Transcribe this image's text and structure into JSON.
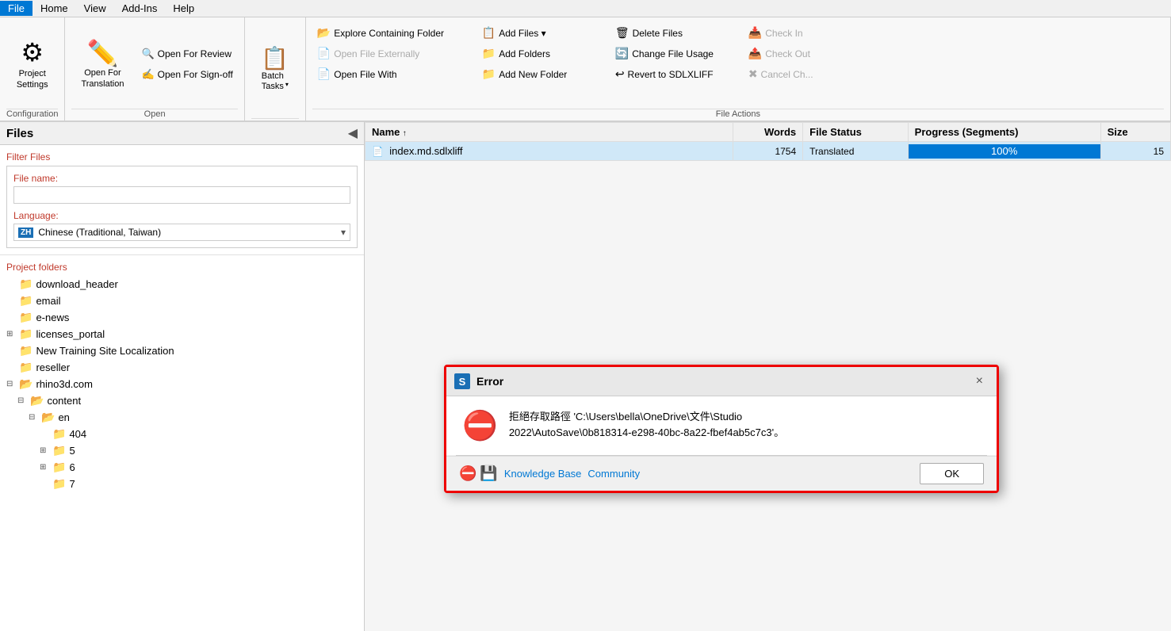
{
  "menubar": {
    "items": [
      {
        "label": "File",
        "active": true
      },
      {
        "label": "Home",
        "active": false
      },
      {
        "label": "View",
        "active": false
      },
      {
        "label": "Add-Ins",
        "active": false
      },
      {
        "label": "Help",
        "active": false
      }
    ]
  },
  "ribbon": {
    "groups": [
      {
        "name": "configuration",
        "label": "Configuration",
        "buttons": [
          {
            "label": "Project\nSettings",
            "sublabel": "Configuration",
            "type": "large",
            "icon": "gear"
          }
        ]
      },
      {
        "name": "open",
        "label": "Open",
        "buttons": [
          {
            "label": "Open For\nTranslation",
            "type": "large",
            "icon": "pencil"
          },
          {
            "label": "Open For Review",
            "type": "small",
            "icon": "review"
          },
          {
            "label": "Open For Sign-off",
            "type": "small",
            "icon": "signoff"
          }
        ]
      },
      {
        "name": "batch",
        "label": "",
        "buttons": [
          {
            "label": "Batch\nTasks",
            "type": "large",
            "icon": "batch"
          }
        ]
      },
      {
        "name": "file-actions",
        "label": "File Actions",
        "buttons": [
          {
            "label": "Explore Containing Folder",
            "type": "small",
            "icon": "folder-open",
            "disabled": false
          },
          {
            "label": "Open File Externally",
            "type": "small",
            "icon": "file-ext",
            "disabled": true
          },
          {
            "label": "Open File With",
            "type": "small",
            "icon": "file-with",
            "disabled": false
          },
          {
            "label": "Add Files",
            "type": "small",
            "icon": "add-files",
            "disabled": false
          },
          {
            "label": "Add Folders",
            "type": "small",
            "icon": "add-folder",
            "disabled": false
          },
          {
            "label": "Add New Folder",
            "type": "small",
            "icon": "add-new-folder",
            "disabled": false
          },
          {
            "label": "Delete Files",
            "type": "small",
            "icon": "delete",
            "disabled": false
          },
          {
            "label": "Change File Usage",
            "type": "small",
            "icon": "change-usage",
            "disabled": false
          },
          {
            "label": "Revert to SDLXLIFF",
            "type": "small",
            "icon": "revert",
            "disabled": false
          },
          {
            "label": "Check In",
            "type": "small",
            "icon": "checkin",
            "disabled": true
          },
          {
            "label": "Check Out",
            "type": "small",
            "icon": "checkout",
            "disabled": true
          },
          {
            "label": "Cancel Ch...",
            "type": "small",
            "icon": "cancelch",
            "disabled": true
          }
        ]
      }
    ]
  },
  "leftpanel": {
    "title": "Files",
    "filter": {
      "title": "Filter Files",
      "filename_label": "File name:",
      "filename_placeholder": "",
      "language_label": "Language:",
      "language_flag": "ZH",
      "language_name": "Chinese (Traditional, Taiwan)"
    },
    "folders_title": "Project folders",
    "folders": [
      {
        "name": "download_header",
        "level": 0,
        "expanded": false,
        "has_children": false
      },
      {
        "name": "email",
        "level": 0,
        "expanded": false,
        "has_children": false
      },
      {
        "name": "e-news",
        "level": 0,
        "expanded": false,
        "has_children": false
      },
      {
        "name": "licenses_portal",
        "level": 0,
        "expanded": true,
        "has_children": true
      },
      {
        "name": "New Training Site Localization",
        "level": 0,
        "expanded": false,
        "has_children": false
      },
      {
        "name": "reseller",
        "level": 0,
        "expanded": false,
        "has_children": false
      },
      {
        "name": "rhino3d.com",
        "level": 0,
        "expanded": true,
        "has_children": true
      },
      {
        "name": "content",
        "level": 1,
        "expanded": true,
        "has_children": true
      },
      {
        "name": "en",
        "level": 2,
        "expanded": true,
        "has_children": true
      },
      {
        "name": "404",
        "level": 3,
        "expanded": false,
        "has_children": false
      },
      {
        "name": "5",
        "level": 3,
        "expanded": true,
        "has_children": true
      },
      {
        "name": "6",
        "level": 3,
        "expanded": true,
        "has_children": true
      },
      {
        "name": "7",
        "level": 3,
        "expanded": false,
        "has_children": false
      }
    ]
  },
  "filetable": {
    "columns": [
      {
        "label": "Name",
        "sortable": true
      },
      {
        "label": "Words"
      },
      {
        "label": "File Status"
      },
      {
        "label": "Progress (Segments)"
      },
      {
        "label": "Size"
      }
    ],
    "rows": [
      {
        "name": "index.md.sdlxliff",
        "words": "1754",
        "status": "Translated",
        "progress": "100%",
        "size": "15",
        "selected": true
      }
    ]
  },
  "error_dialog": {
    "title": "Error",
    "title_icon": "S",
    "message_line1": "拒絕存取路徑 'C:\\Users\\bella\\OneDrive\\文件\\Studio",
    "message_line2": "2022\\AutoSave\\0b818314-e298-40bc-8a22-fbef4ab5c7c3'。",
    "link1": "Knowledge Base",
    "link2": "Community",
    "ok_button": "OK",
    "close_button": "×"
  }
}
